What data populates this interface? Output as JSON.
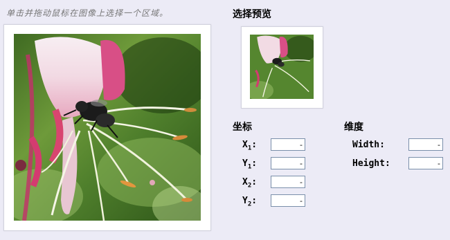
{
  "hint_text": "单击并拖动鼠标在图像上选择一个区域。",
  "preview_title": "选择预览",
  "coords": {
    "title": "坐标",
    "x1": {
      "letter": "X",
      "sub": "1",
      "suffix": ":",
      "value": "-"
    },
    "y1": {
      "letter": "Y",
      "sub": "1",
      "suffix": ":",
      "value": "-"
    },
    "x2": {
      "letter": "X",
      "sub": "2",
      "suffix": ":",
      "value": "-"
    },
    "y2": {
      "letter": "Y",
      "sub": "2",
      "suffix": ":",
      "value": "-"
    }
  },
  "dimensions": {
    "title": "维度",
    "width_label": "Width:",
    "width_value": "-",
    "height_label": "Height:",
    "height_value": "-"
  }
}
